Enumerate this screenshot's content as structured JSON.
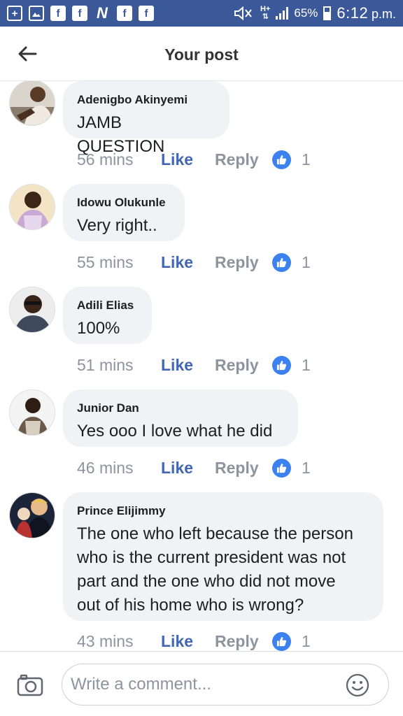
{
  "status_bar": {
    "battery": "65%",
    "network": "H+",
    "time": "6:12",
    "ampm": "p.m."
  },
  "header": {
    "title": "Your post"
  },
  "comments": [
    {
      "author": "Adenigbo Akinyemi",
      "text": "JAMB QUESTION",
      "time": "56 mins",
      "like_label": "Like",
      "reply_label": "Reply",
      "likes": "1"
    },
    {
      "author": "Idowu Olukunle",
      "text": "Very right..",
      "time": "55 mins",
      "like_label": "Like",
      "reply_label": "Reply",
      "likes": "1"
    },
    {
      "author": "Adili Elias",
      "text": "100%",
      "time": "51 mins",
      "like_label": "Like",
      "reply_label": "Reply",
      "likes": "1"
    },
    {
      "author": "Junior Dan",
      "text": "Yes ooo I love what he did",
      "time": "46 mins",
      "like_label": "Like",
      "reply_label": "Reply",
      "likes": "1"
    },
    {
      "author": "Prince Elijimmy",
      "text_lines": [
        "The one who left because the person",
        "who is the current president was not",
        "part and the one who did not move",
        "out of his home who is wrong?"
      ],
      "time": "43 mins",
      "like_label": "Like",
      "reply_label": "Reply",
      "likes": "1"
    }
  ],
  "composer": {
    "placeholder": "Write a comment..."
  },
  "colors": {
    "status_bar": "#3b5998",
    "like_blue": "#4267b2",
    "reaction_blue": "#3b82f0",
    "bubble": "#f0f2f5",
    "muted": "#8d949e"
  },
  "icons": [
    "plus-icon",
    "gallery-icon",
    "facebook-icon",
    "facebook-icon",
    "n-app-icon",
    "facebook-icon",
    "facebook-icon",
    "mute-icon",
    "signal-icon",
    "battery-icon",
    "back-arrow-icon",
    "thumbs-up-icon",
    "camera-icon",
    "emoji-icon"
  ]
}
